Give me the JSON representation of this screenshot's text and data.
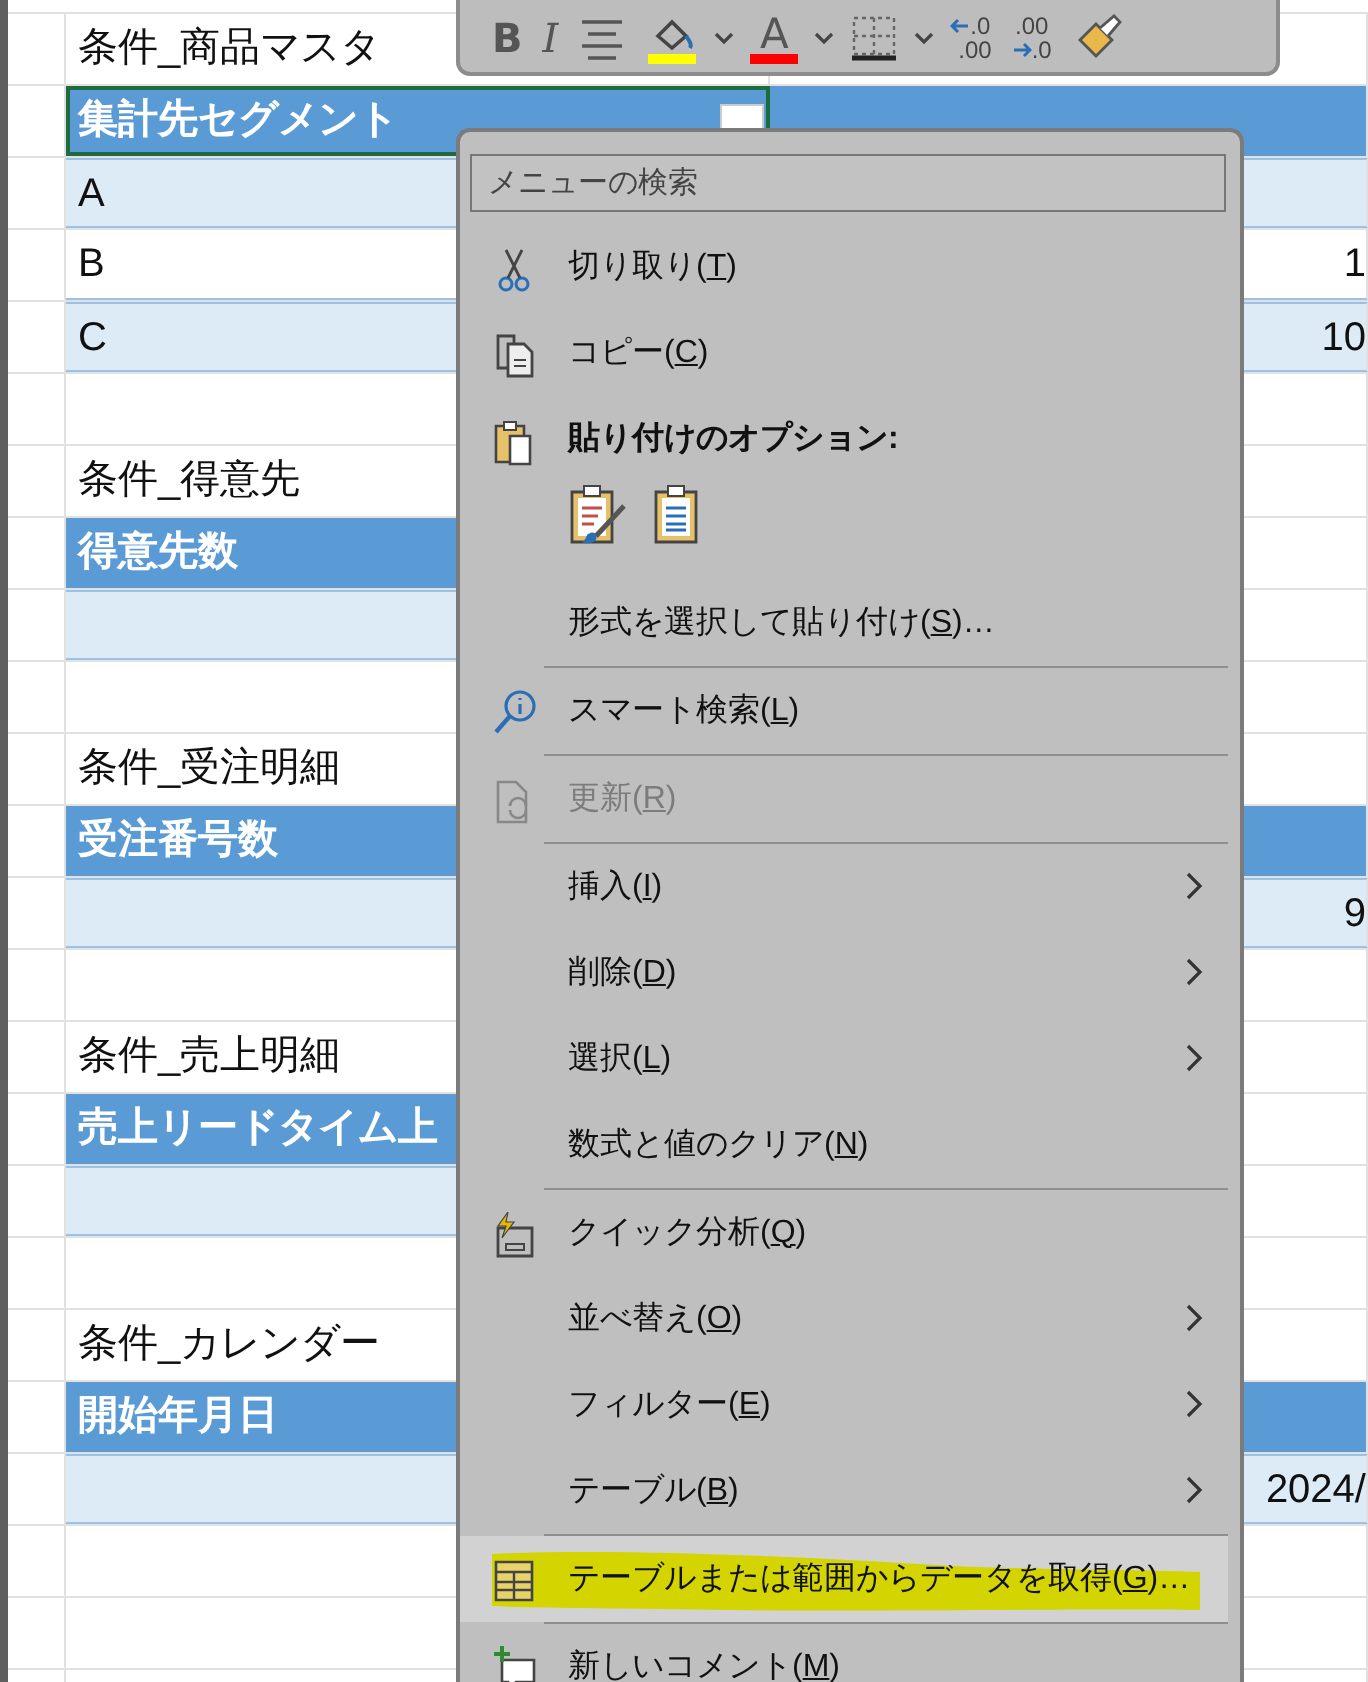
{
  "sheet": {
    "rows": [
      {
        "kind": "title",
        "b": "条件_商品マスタ"
      },
      {
        "kind": "header",
        "wide": true,
        "b": "集計先セグメント",
        "selected": true,
        "filter": true
      },
      {
        "kind": "band",
        "wide": true,
        "b": "A"
      },
      {
        "kind": "row",
        "wide": true,
        "b": "B",
        "c": "1"
      },
      {
        "kind": "band",
        "wide": true,
        "b": "C",
        "c": "10"
      },
      {
        "kind": "empty"
      },
      {
        "kind": "title",
        "b": "条件_得意先"
      },
      {
        "kind": "header",
        "wide": false,
        "b": "得意先数"
      },
      {
        "kind": "band",
        "wide": false
      },
      {
        "kind": "empty"
      },
      {
        "kind": "title",
        "b": "条件_受注明細"
      },
      {
        "kind": "header",
        "wide": true,
        "b": "受注番号数"
      },
      {
        "kind": "band",
        "wide": true,
        "c": "9"
      },
      {
        "kind": "empty"
      },
      {
        "kind": "title",
        "b": "条件_売上明細"
      },
      {
        "kind": "header",
        "wide": false,
        "b": "売上リードタイム上"
      },
      {
        "kind": "band",
        "wide": false
      },
      {
        "kind": "empty"
      },
      {
        "kind": "title",
        "b": "条件_カレンダー"
      },
      {
        "kind": "header",
        "wide": true,
        "b": "開始年月日"
      },
      {
        "kind": "band",
        "wide": true,
        "c": "2024/"
      },
      {
        "kind": "empty"
      },
      {
        "kind": "empty"
      },
      {
        "kind": "empty"
      }
    ]
  },
  "mini_toolbar": [
    {
      "kind": "bold",
      "label": "B",
      "dropdown": false
    },
    {
      "kind": "italic",
      "label": "I",
      "dropdown": false
    },
    {
      "kind": "align",
      "dropdown": false
    },
    {
      "kind": "fill-color",
      "color": "#ffff00",
      "dropdown": true
    },
    {
      "kind": "font-color",
      "label": "A",
      "color": "#ff0000",
      "dropdown": true
    },
    {
      "kind": "borders",
      "dropdown": true
    },
    {
      "kind": "increase-decimal",
      "top": ".0",
      "bottom": ".00",
      "dropdown": false
    },
    {
      "kind": "decrease-decimal",
      "top": ".00",
      "bottom": ".0",
      "dropdown": false
    },
    {
      "kind": "format-painter",
      "dropdown": false
    }
  ],
  "context_menu": {
    "search": {
      "placeholder": "メニューの検索"
    },
    "items": [
      {
        "kind": "cut",
        "before": "切り取り(",
        "key": "T",
        "after": ")",
        "submenu": false,
        "disabled": false,
        "selected": false
      },
      {
        "kind": "copy",
        "before": "コピー(",
        "key": "C",
        "after": ")",
        "submenu": false,
        "disabled": false,
        "selected": false
      },
      {
        "kind": "heading",
        "label": "貼り付けのオプション:"
      },
      {
        "kind": "paste-options",
        "options": [
          {
            "kind": "formatting"
          },
          {
            "kind": "values"
          }
        ]
      },
      {
        "kind": "command",
        "before": "形式を選択して貼り付け(",
        "key": "S",
        "after": ")…",
        "submenu": false,
        "disabled": false,
        "selected": false
      },
      {
        "kind": "divider"
      },
      {
        "kind": "smart-lookup",
        "before": "スマート検索(",
        "key": "L",
        "after": ")",
        "submenu": false,
        "disabled": false,
        "selected": false
      },
      {
        "kind": "divider"
      },
      {
        "kind": "refresh",
        "before": "更新(",
        "key": "R",
        "after": ")",
        "submenu": false,
        "disabled": true,
        "selected": false
      },
      {
        "kind": "divider"
      },
      {
        "kind": "command",
        "before": "挿入(",
        "key": "I",
        "after": ")",
        "submenu": true,
        "disabled": false,
        "selected": false
      },
      {
        "kind": "command",
        "before": "削除(",
        "key": "D",
        "after": ")",
        "submenu": true,
        "disabled": false,
        "selected": false
      },
      {
        "kind": "command",
        "before": "選択(",
        "key": "L",
        "after": ")",
        "submenu": true,
        "disabled": false,
        "selected": false
      },
      {
        "kind": "command",
        "before": "数式と値のクリア(",
        "key": "N",
        "after": ")",
        "submenu": false,
        "disabled": false,
        "selected": false
      },
      {
        "kind": "divider"
      },
      {
        "kind": "quick-analysis",
        "before": "クイック分析(",
        "key": "Q",
        "after": ")",
        "submenu": false,
        "disabled": false,
        "selected": false
      },
      {
        "kind": "command",
        "before": "並べ替え(",
        "key": "O",
        "after": ")",
        "submenu": true,
        "disabled": false,
        "selected": false
      },
      {
        "kind": "command",
        "before": "フィルター(",
        "key": "E",
        "after": ")",
        "submenu": true,
        "disabled": false,
        "selected": false
      },
      {
        "kind": "command",
        "before": "テーブル(",
        "key": "B",
        "after": ")",
        "submenu": true,
        "disabled": false,
        "selected": false
      },
      {
        "kind": "divider"
      },
      {
        "kind": "get-data",
        "before": "テーブルまたは範囲からデータを取得(",
        "key": "G",
        "after": ")…",
        "submenu": false,
        "disabled": false,
        "selected": true,
        "marked": true
      },
      {
        "kind": "divider"
      },
      {
        "kind": "new-comment",
        "before": "新しいコメント(",
        "key": "M",
        "after": ")",
        "submenu": false,
        "disabled": false,
        "selected": false
      }
    ]
  }
}
